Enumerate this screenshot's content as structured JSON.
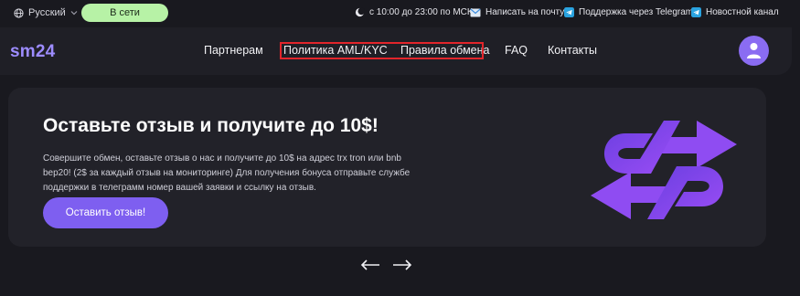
{
  "topbar": {
    "language": "Русский",
    "status": "В сети",
    "hours": "с 10:00 до 23:00 по МСК",
    "email_link": "Написать на почту",
    "support_link": "Поддержка через Telegram",
    "news_link": "Новостной канал"
  },
  "nav": {
    "logo": "sm24",
    "items": [
      "Партнерам",
      "Политика AML/KYC",
      "Правила обмена",
      "FAQ",
      "Контакты"
    ]
  },
  "hero": {
    "title": "Оставьте отзыв и получите до 10$!",
    "text": "Совершите обмен, оставьте отзыв о нас и получите до 10$ на адрес trx tron или bnb bep20! (2$ за каждый отзыв на мониторинге) Для получения бонуса отправьте службе поддержки в телеграмм номер вашей заявки и ссылку на отзыв.",
    "cta": "Оставить отзыв!"
  },
  "slider": {
    "prev_icon": "arrow-left-icon",
    "next_icon": "arrow-right-icon"
  },
  "colors": {
    "background": "#19191f",
    "accent": "#7e5ff0",
    "logo": "#9d8cff",
    "status_bg": "#b7f2a6",
    "highlight_box": "#e2252b"
  }
}
